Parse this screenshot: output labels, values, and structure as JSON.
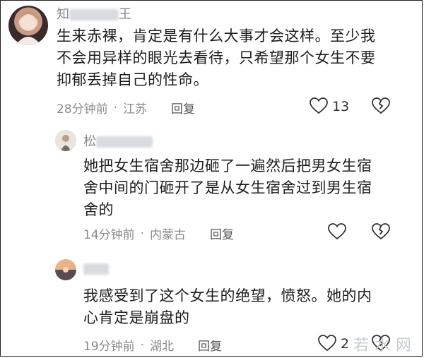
{
  "comments": [
    {
      "author_visible": "知",
      "author_tail": "王",
      "text_lines": [
        "生来赤裸，肯定是有什么大事才会这样。至少我",
        "不会用异样的眼光去看待，只希望那个女生不要",
        "抑郁丢掉自己的性命。"
      ],
      "time": "28分钟前",
      "location": "江苏",
      "reply_label": "回复",
      "like_count": "13"
    },
    {
      "author_visible": "松",
      "text_lines": [
        "她把女生宿舍那边砸了一遍然后把男女生宿",
        "舍中间的门砸开了是从女生宿舍过到男生宿",
        "舍的"
      ],
      "time": "14分钟前",
      "location": "内蒙古",
      "reply_label": "回复"
    },
    {
      "author_visible": "",
      "text_lines": [
        "我感受到了这个女生的绝望，愤怒。她的内",
        "心肯定是崩盘的"
      ],
      "time": "19分钟前",
      "location": "湖北",
      "reply_label": "回复",
      "like_count": "2"
    }
  ],
  "dot": "·",
  "watermark": "若水网",
  "icons": [
    "avatar-photo",
    "heart-outline-icon",
    "broken-heart-icon"
  ]
}
